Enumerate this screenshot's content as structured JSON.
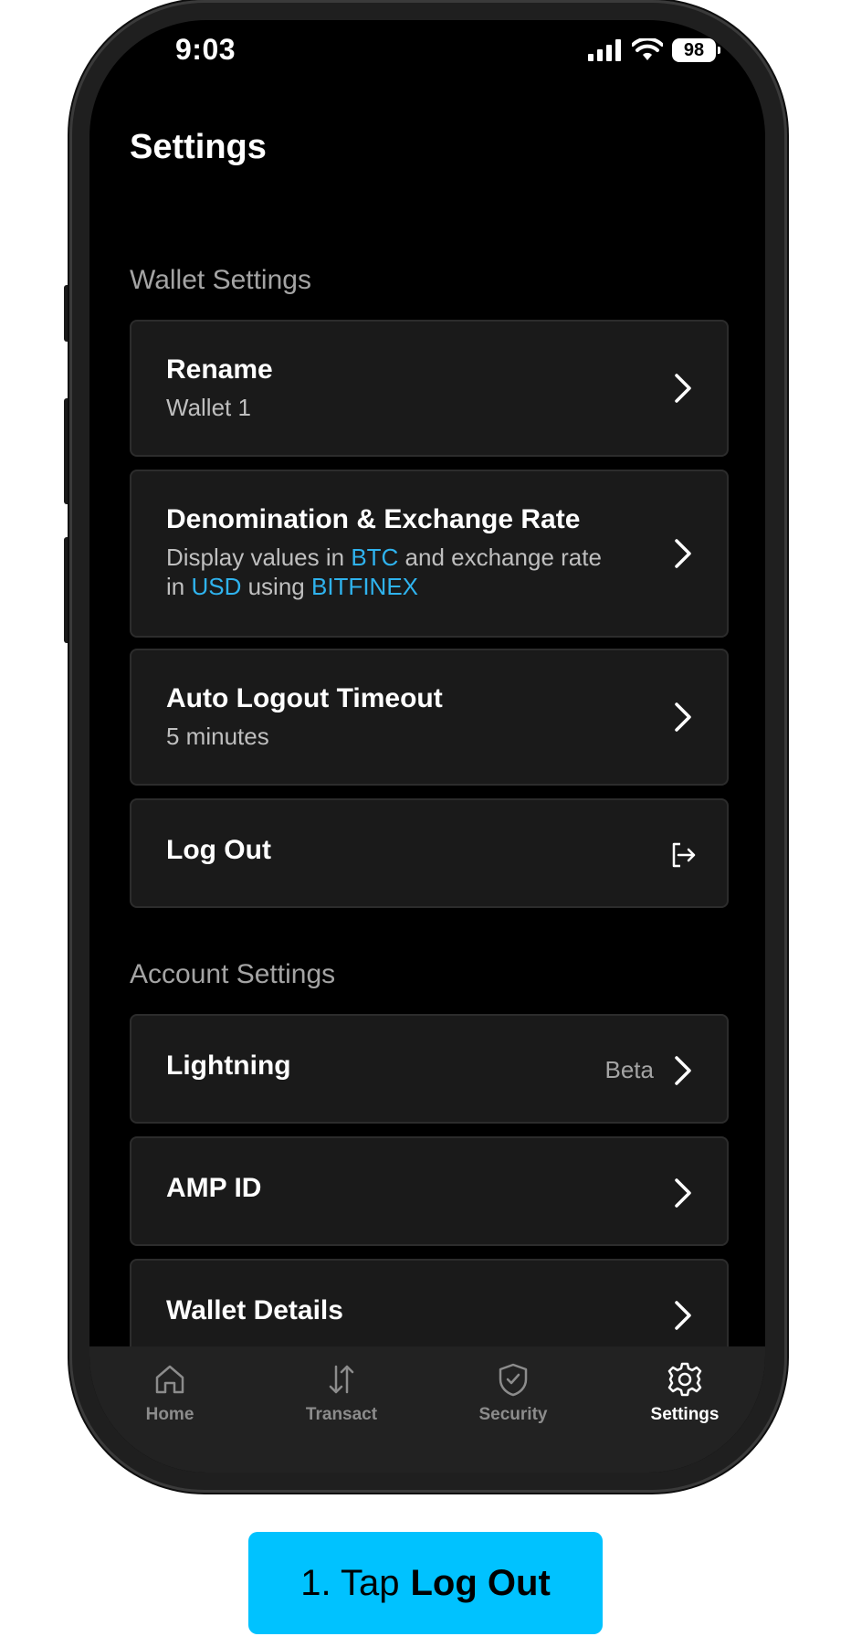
{
  "status_bar": {
    "time": "9:03",
    "battery": "98"
  },
  "page": {
    "title": "Settings"
  },
  "wallet_settings": {
    "heading": "Wallet Settings",
    "rename": {
      "title": "Rename",
      "subtitle": "Wallet 1"
    },
    "denomination": {
      "title": "Denomination & Exchange Rate",
      "sub_part1": "Display values in ",
      "sub_unit": "BTC",
      "sub_part2": " and exchange rate",
      "sub_part3": "in ",
      "sub_currency": "USD",
      "sub_part4": " using ",
      "sub_exchange": "BITFINEX"
    },
    "auto_logout": {
      "title": "Auto Logout Timeout",
      "subtitle": "5 minutes"
    },
    "logout": {
      "title": "Log Out"
    }
  },
  "account_settings": {
    "heading": "Account Settings",
    "lightning": {
      "title": "Lightning",
      "badge": "Beta"
    },
    "amp_id": {
      "title": "AMP ID"
    },
    "wallet_details": {
      "title": "Wallet Details"
    }
  },
  "tab_bar": {
    "tabs": [
      {
        "label": "Home",
        "icon": "home-icon",
        "active": false
      },
      {
        "label": "Transact",
        "icon": "transact-icon",
        "active": false
      },
      {
        "label": "Security",
        "icon": "shield-icon",
        "active": false
      },
      {
        "label": "Settings",
        "icon": "gear-icon",
        "active": true
      }
    ]
  },
  "caption": {
    "step": "1. Tap",
    "action": "Log Out"
  },
  "colors": {
    "background": "#000000",
    "card": "#1a1a1a",
    "accent": "#2fb3ee",
    "caption_button": "#00c2ff"
  }
}
